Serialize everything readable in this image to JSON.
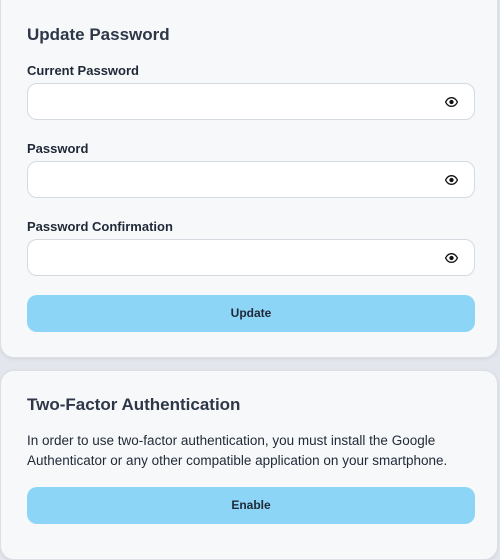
{
  "update_password": {
    "title": "Update Password",
    "fields": [
      {
        "label": "Current Password",
        "value": "",
        "icon": "eye-icon"
      },
      {
        "label": "Password",
        "value": "",
        "icon": "eye-icon"
      },
      {
        "label": "Password Confirmation",
        "value": "",
        "icon": "eye-icon"
      }
    ],
    "button_label": "Update",
    "button_color": "#8dd5f7"
  },
  "two_factor": {
    "title": "Two-Factor Authentication",
    "description": "In order to use two-factor authentication, you must install the Google Authenticator or any other compatible application on your smartphone.",
    "button_label": "Enable"
  }
}
